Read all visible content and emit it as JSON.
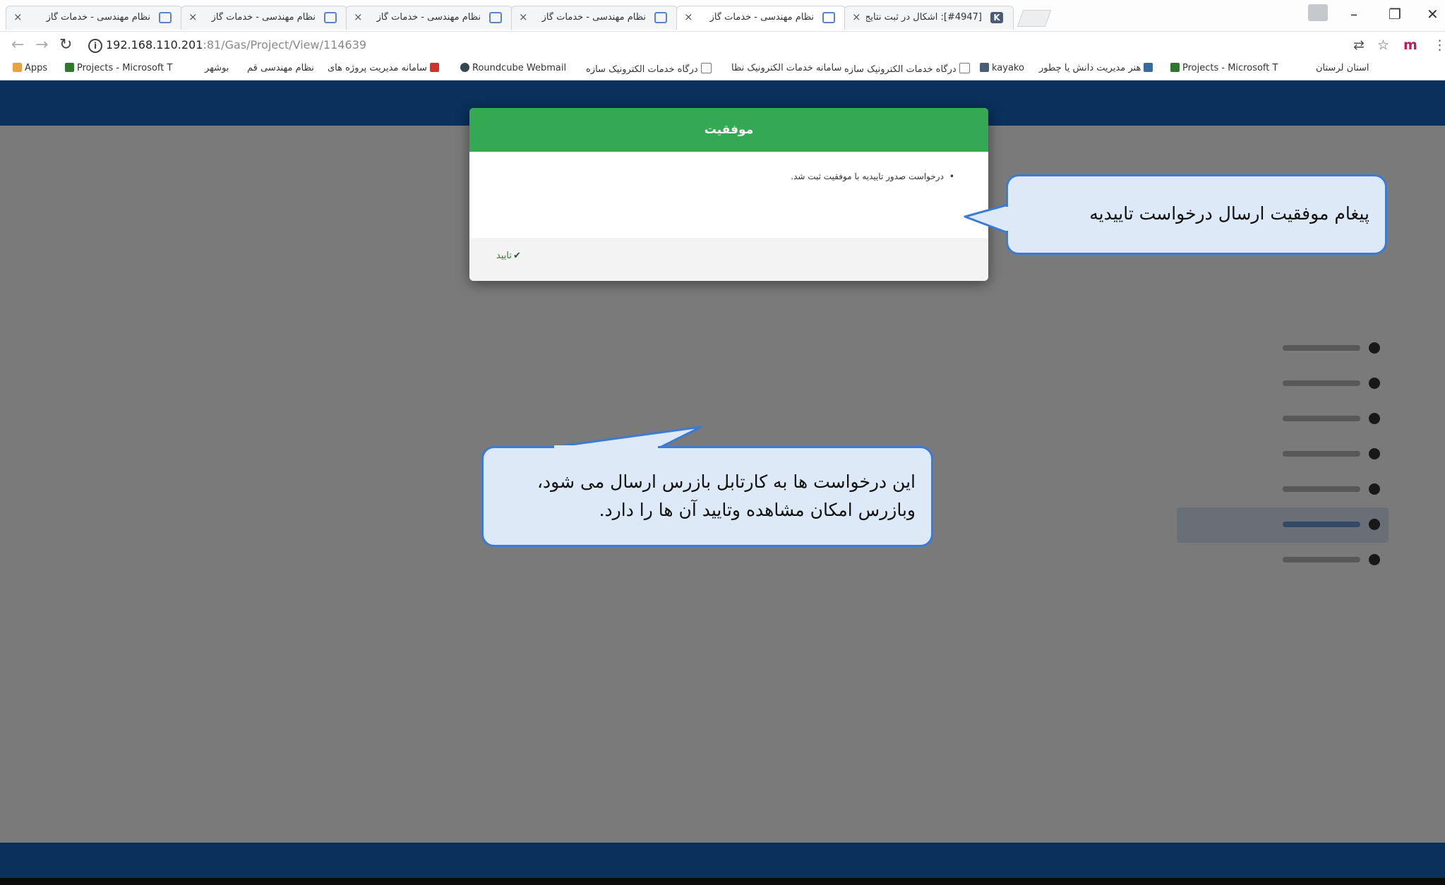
{
  "browser": {
    "tabs": [
      {
        "title": "نظام مهندسی - خدمات گاز",
        "icon": "page-icon"
      },
      {
        "title": "نظام مهندسی - خدمات گاز",
        "icon": "page-icon"
      },
      {
        "title": "نظام مهندسی - خدمات گاز",
        "icon": "page-icon"
      },
      {
        "title": "نظام مهندسی - خدمات گاز",
        "icon": "page-icon"
      },
      {
        "title": "نظام مهندسی - خدمات گاز",
        "icon": "page-icon"
      },
      {
        "title": "[#4947]: اشکال در ثبت نتایج",
        "icon": "kayako-icon",
        "favicon_letter": "K"
      }
    ],
    "tab_close_glyph": "×",
    "address": {
      "host": "192.168.110.201",
      "path": ":81/Gas/Project/View/114639"
    },
    "bookmarks": [
      {
        "label": "Apps",
        "icon": "apps-grid-icon"
      },
      {
        "label": "Projects - Microsoft T",
        "icon": "microsoft-project-icon"
      },
      {
        "label": "بوشهر",
        "icon": "folder-icon"
      },
      {
        "label": "نظام مهندسی قم",
        "icon": "separator-icon"
      },
      {
        "label": "سامانه مدیریت پروژه های",
        "icon": "map-pin-icon"
      },
      {
        "label": "Roundcube Webmail",
        "icon": "roundcube-icon"
      },
      {
        "label": "درگاه خدمات الکترونیک سازه",
        "icon": "page-icon"
      },
      {
        "label": "سامانه خدمات الکترونیک نظا",
        "icon": "page-icon"
      },
      {
        "label": "درگاه خدمات الکترونیک سازه",
        "icon": "page-icon"
      },
      {
        "label": "kayako",
        "icon": "kayako-icon"
      },
      {
        "label": "هنر مدیریت دانش یا چطور",
        "icon": "map-pin-icon"
      },
      {
        "label": "Projects - Microsoft T",
        "icon": "microsoft-project-icon"
      },
      {
        "label": "استان لرستان",
        "icon": "separator-icon"
      }
    ]
  },
  "modal": {
    "title": "موفقیت",
    "messages": [
      "درخواست صدور تاییدیه با موفقیت ثبت شد."
    ],
    "confirm_label": "تایید",
    "confirm_icon": "check-icon",
    "header_color": "#34a853"
  },
  "callouts": {
    "success_message": "پیغام موفقیت ارسال درخواست تاییدیه",
    "inspector_line1": "این درخواست ها به کارتابل بازرس ارسال می شود،",
    "inspector_line2": "وبازرس امکان مشاهده وتایید آن ها را دارد."
  },
  "colors": {
    "nav_blue": "#1565c0",
    "callout_border": "#3a7bd5",
    "callout_fill": "#dde9f7"
  }
}
